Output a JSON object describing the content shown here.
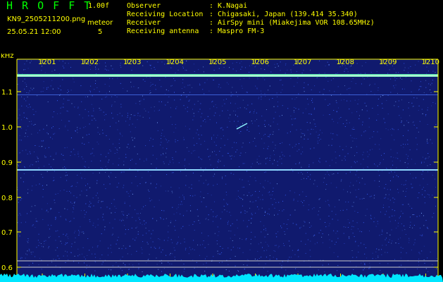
{
  "header": {
    "title": "H R O F F T",
    "version": "1.00f",
    "file_name": "KN9_2505211200.png",
    "observed_at": "25.05.21 12:00",
    "meteor_label": "meteor",
    "meteor_count": "5",
    "info": [
      {
        "label": "Observer",
        "value": ": K.Nagai"
      },
      {
        "label": "Receiving Location",
        "value": ": Chigasaki, Japan (139.414 35.340)"
      },
      {
        "label": "Receiver",
        "value": ": AirSpy mini (Miakejima VOR 108.65MHz)"
      },
      {
        "label": "Receiving antenna",
        "value": ": Maspro FM-3"
      }
    ]
  },
  "spectrogram": {
    "y_unit": "kHz",
    "time_ticks": [
      "1201",
      "1202",
      "1203",
      "1204",
      "1205",
      "1206",
      "1207",
      "1208",
      "1209",
      "1210"
    ],
    "freq_ticks": [
      "1.1",
      "1.0",
      "0.9",
      "0.8",
      "0.7",
      "0.6"
    ],
    "colors": {
      "background": "#101a6e",
      "noise": "#3a64ff",
      "strong_line": "#9cffd0",
      "frame": "#ffff00",
      "baseline": "#00e6ff"
    }
  }
}
